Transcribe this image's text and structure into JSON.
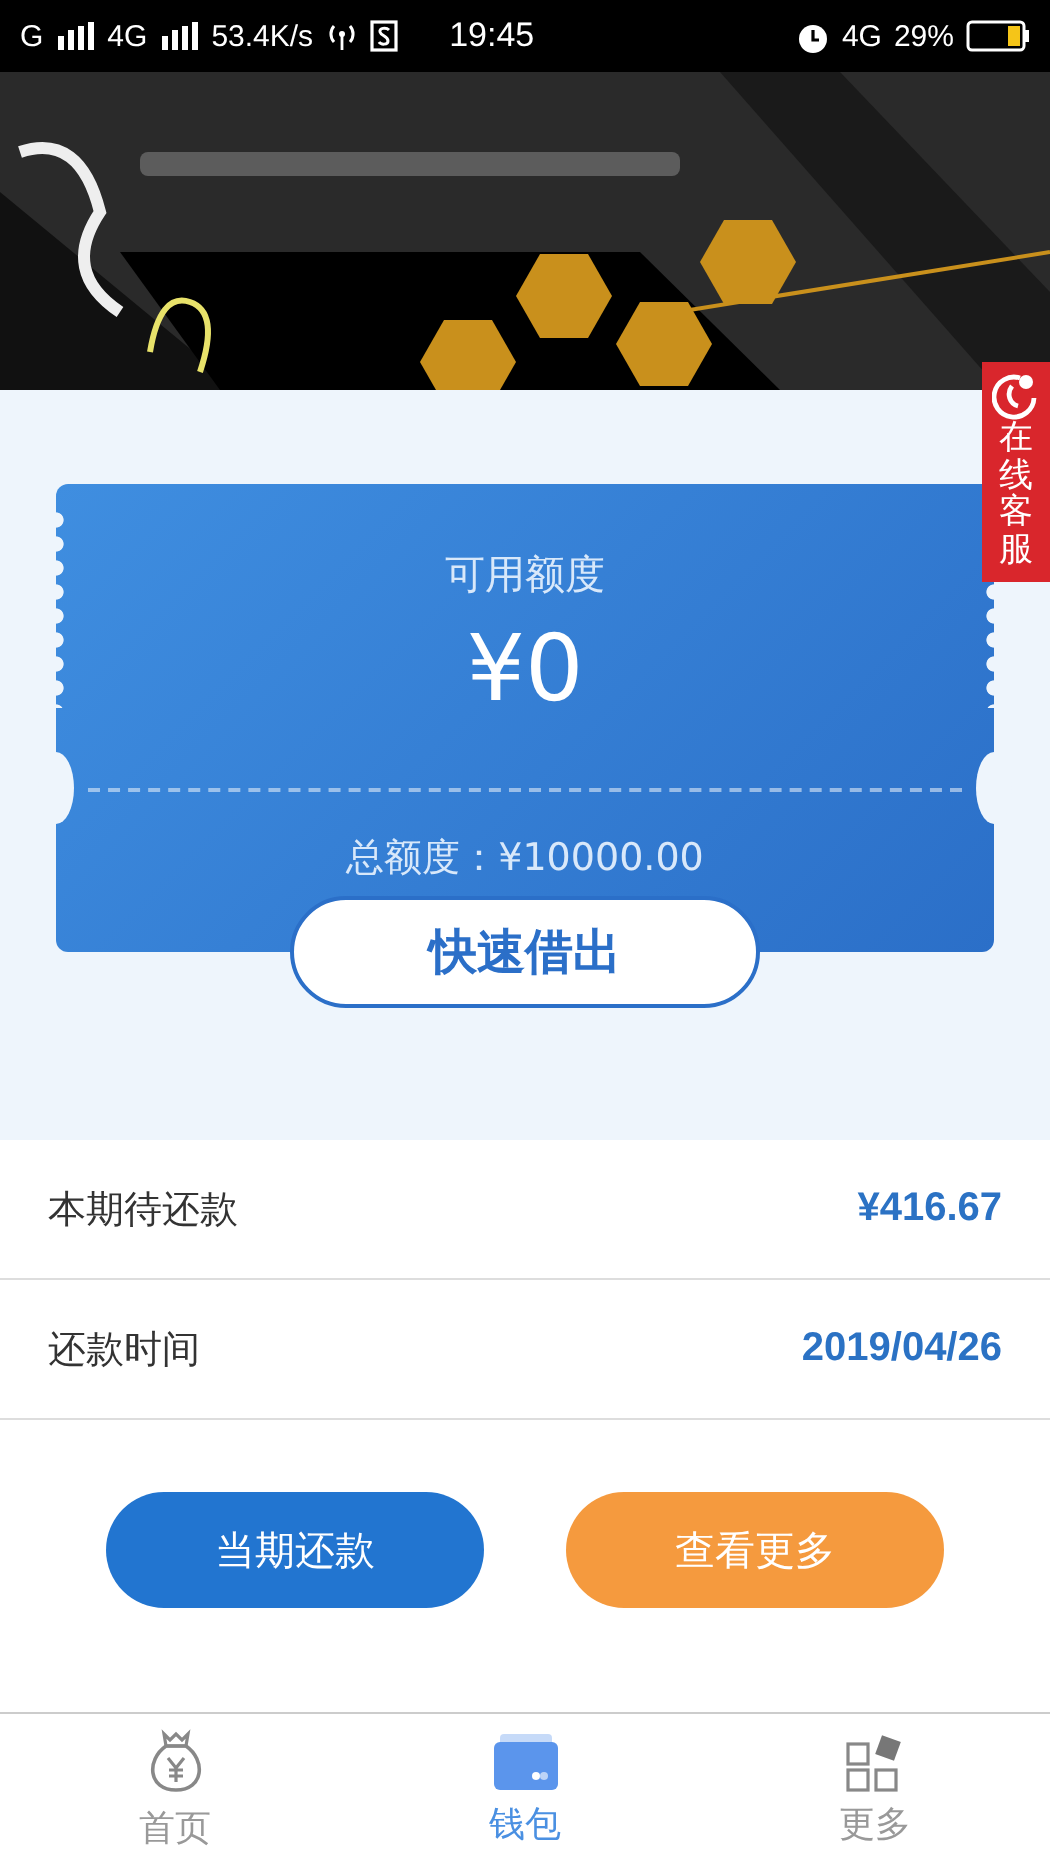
{
  "status_bar": {
    "carrier_1": "G",
    "carrier_2": "4G",
    "speed": "53.4K/s",
    "time": "19:45",
    "network": "4G",
    "battery": "29%"
  },
  "service_button": {
    "label": "在线客服"
  },
  "credit_card": {
    "title": "可用额度",
    "available": "¥0",
    "total": "总额度：¥10000.00",
    "action": "快速借出"
  },
  "details": [
    {
      "label": "本期待还款",
      "value": "¥416.67"
    },
    {
      "label": "还款时间",
      "value": "2019/04/26"
    }
  ],
  "actions": [
    {
      "label": "当期还款",
      "kind": "primary"
    },
    {
      "label": "查看更多",
      "kind": "secondary"
    }
  ],
  "tabs": [
    {
      "label": "首页",
      "kind": "money-bag",
      "selected": false
    },
    {
      "label": "钱包",
      "kind": "wallet",
      "selected": true
    },
    {
      "label": "更多",
      "kind": "grid",
      "selected": false
    }
  ]
}
